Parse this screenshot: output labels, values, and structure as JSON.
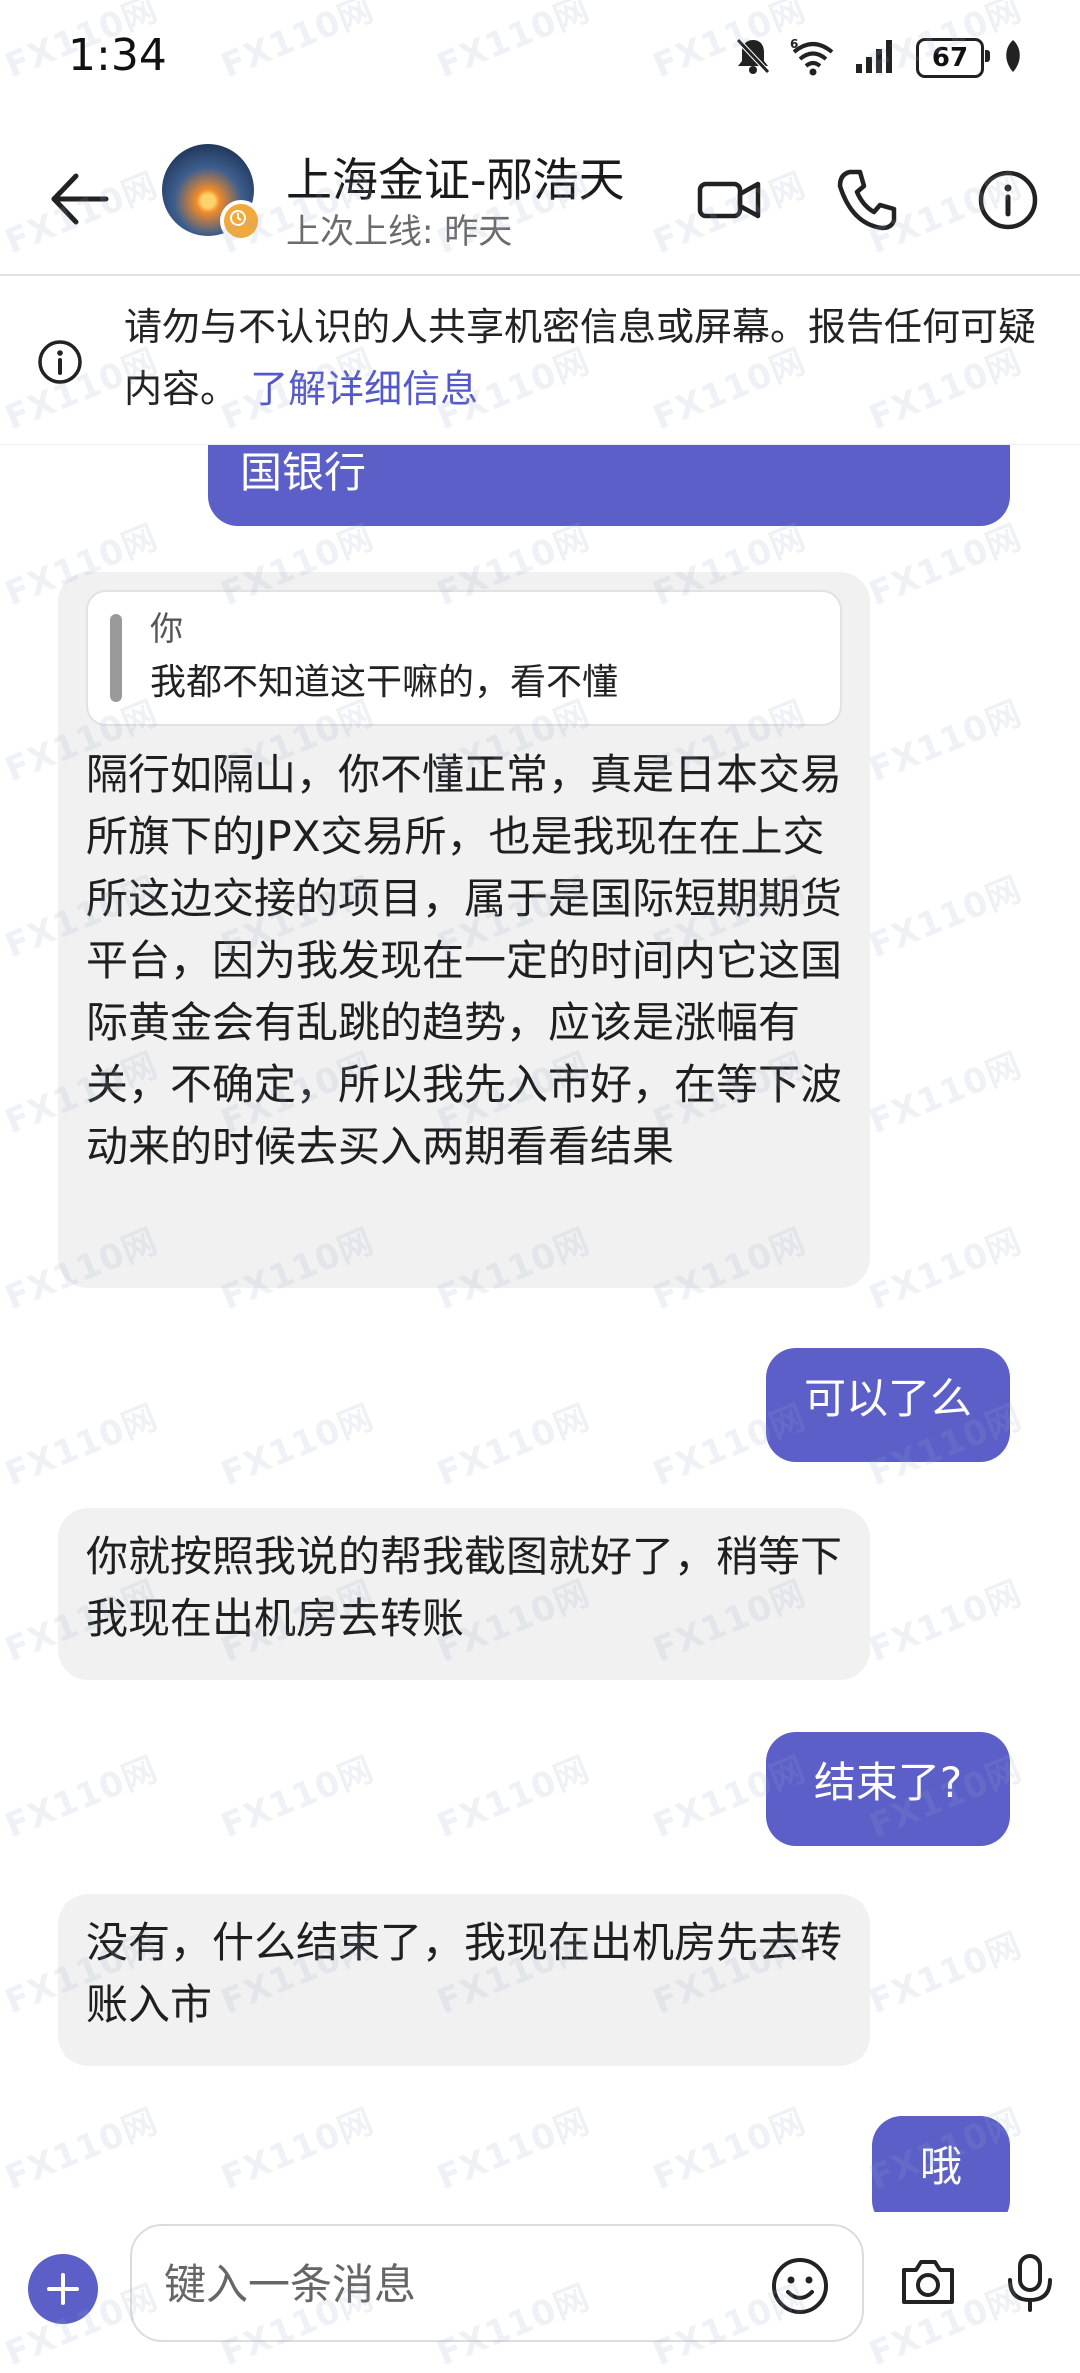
{
  "status_bar": {
    "time": "1:34",
    "battery": "67"
  },
  "header": {
    "contact_name": "上海金证-邴浩天",
    "last_seen": "上次上线: 昨天"
  },
  "banner": {
    "text": "请勿与不认识的人共享机密信息或屏幕。报告任何可疑内容。",
    "link": "了解详细信息"
  },
  "messages": {
    "m0": "国银行",
    "m1_quote_author": "你",
    "m1_quote_text": "我都不知道这干嘛的，看不懂",
    "m1": "隔行如隔山，你不懂正常，真是日本交易所旗下的JPX交易所，也是我现在在上交所这边交接的项目，属于是国际短期期货平台，因为我发现在一定的时间内它这国际黄金会有乱跳的趋势，应该是涨幅有关，不确定，所以我先入市好，在等下波动来的时候去买入两期看看结果",
    "m2": "可以了么",
    "m3": "你就按照我说的帮我截图就好了，稍等下我现在出机房去转账",
    "m4": "结束了?",
    "m5": "没有，什么结束了，我现在出机房先去转账入市",
    "m6": "哦"
  },
  "composer": {
    "placeholder": "键入一条消息"
  },
  "watermark": {
    "text": "FX110网"
  },
  "colors": {
    "accent": "#5b5fc7",
    "incoming_bubble": "#f1f1f1",
    "link": "#5558c8"
  }
}
